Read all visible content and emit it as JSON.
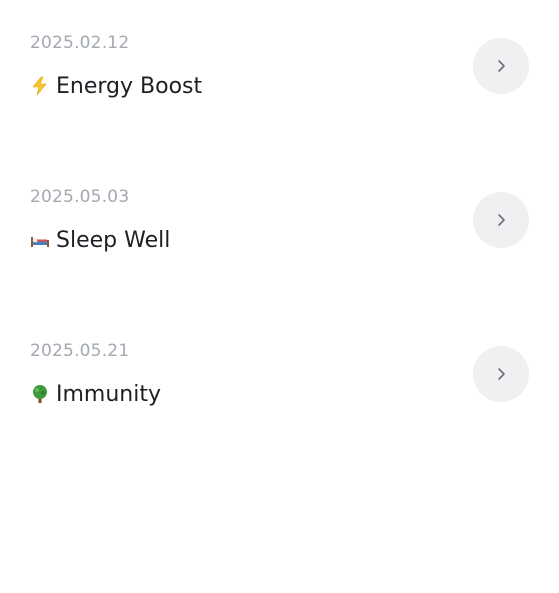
{
  "items": [
    {
      "date": "2025.02.12",
      "title": "Energy Boost",
      "icon": "lightning-icon"
    },
    {
      "date": "2025.05.03",
      "title": "Sleep Well",
      "icon": "bed-icon"
    },
    {
      "date": "2025.05.21",
      "title": "Immunity",
      "icon": "tree-icon"
    }
  ],
  "colors": {
    "date": "#a3a8b2",
    "title": "#1e1f24",
    "button_bg": "#f0f0f2",
    "chevron": "#6b6f78"
  }
}
